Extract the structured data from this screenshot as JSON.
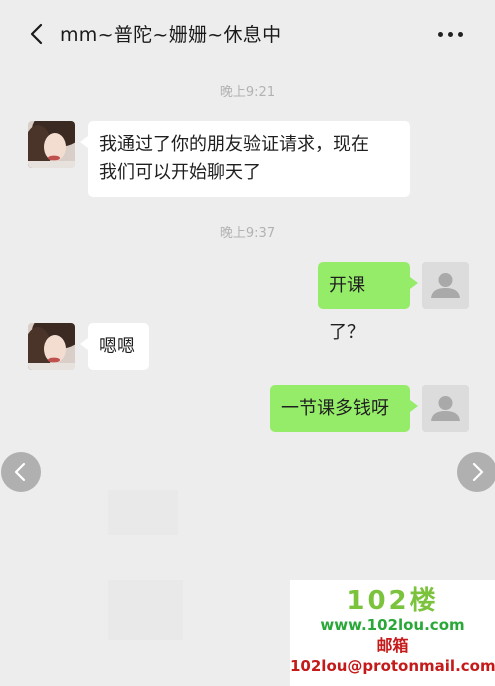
{
  "header": {
    "title": "mm~普陀~姗姗~休息中"
  },
  "messages": {
    "ts1": "晚上9:21",
    "m1_line1": "我通过了你的朋友验证请求，现在",
    "m1_line2": "我们可以开始聊天了",
    "ts2": "晚上9:37",
    "m2": "开课了？",
    "m3": "嗯嗯",
    "m4": "一节课多钱呀"
  },
  "watermark": {
    "logo": "102楼",
    "site": "www.102lou.com",
    "label": "邮箱",
    "email": "102lou@protonmail.com"
  },
  "colors": {
    "background": "#ededed",
    "sent_bubble": "#95ec69",
    "received_bubble": "#ffffff"
  }
}
